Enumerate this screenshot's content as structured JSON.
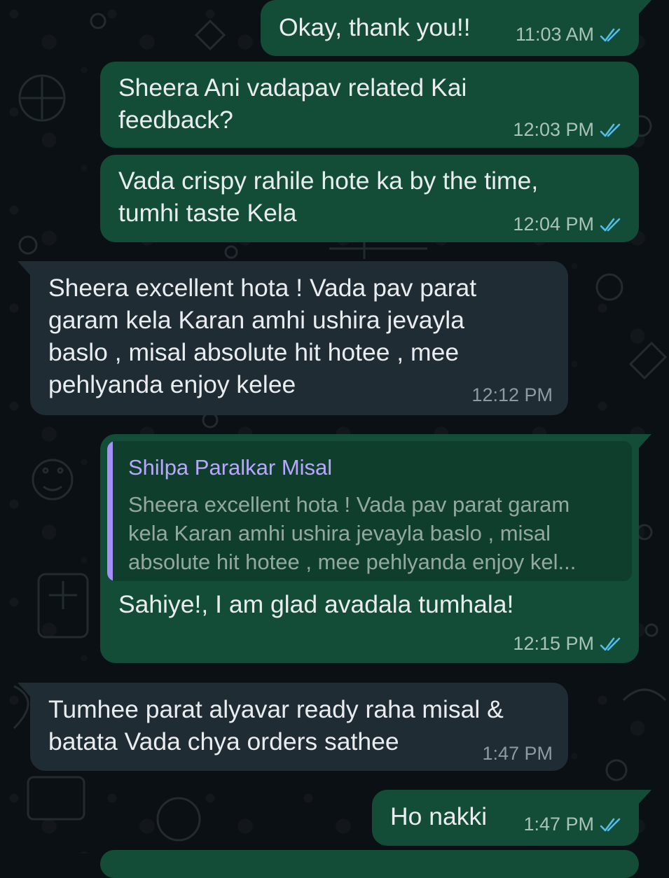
{
  "messages": [
    {
      "direction": "outgoing",
      "text": "Okay, thank you!!",
      "time": "11:03 AM",
      "status": "read-double-check-icon"
    },
    {
      "direction": "outgoing",
      "text": "Sheera Ani vadapav related Kai\nfeedback?",
      "time": "12:03 PM",
      "status": "read-double-check-icon"
    },
    {
      "direction": "outgoing",
      "text": "Vada crispy rahile hote ka by the time,\ntumhi taste Kela",
      "time": "12:04 PM",
      "status": "read-double-check-icon"
    },
    {
      "direction": "incoming",
      "text": "Sheera excellent hota ! Vada pav parat\ngaram kela Karan amhi ushira jevayla\nbaslo , misal absolute hit hotee , mee\npehlyanda enjoy kelee",
      "time": "12:12 PM"
    },
    {
      "direction": "outgoing",
      "quote": {
        "author": "Shilpa Paralkar Misal",
        "text": "Sheera excellent hota ! Vada pav parat garam\nkela Karan amhi ushira jevayla baslo , misal\nabsolute hit hotee , mee pehlyanda enjoy kel..."
      },
      "text": "Sahiye!, I am glad avadala tumhala!",
      "time": "12:15 PM",
      "status": "read-double-check-icon"
    },
    {
      "direction": "incoming",
      "text": "Tumhee parat alyavar ready raha misal &\nbatata Vada chya orders sathee",
      "time": "1:47 PM"
    },
    {
      "direction": "outgoing",
      "text": "Ho nakki",
      "time": "1:47 PM",
      "status": "read-double-check-icon"
    }
  ],
  "colors": {
    "outgoing_bubble": "#144d37",
    "incoming_bubble": "#202c33",
    "read_ticks": "#53bdeb",
    "quote_accent": "#a590f5"
  }
}
